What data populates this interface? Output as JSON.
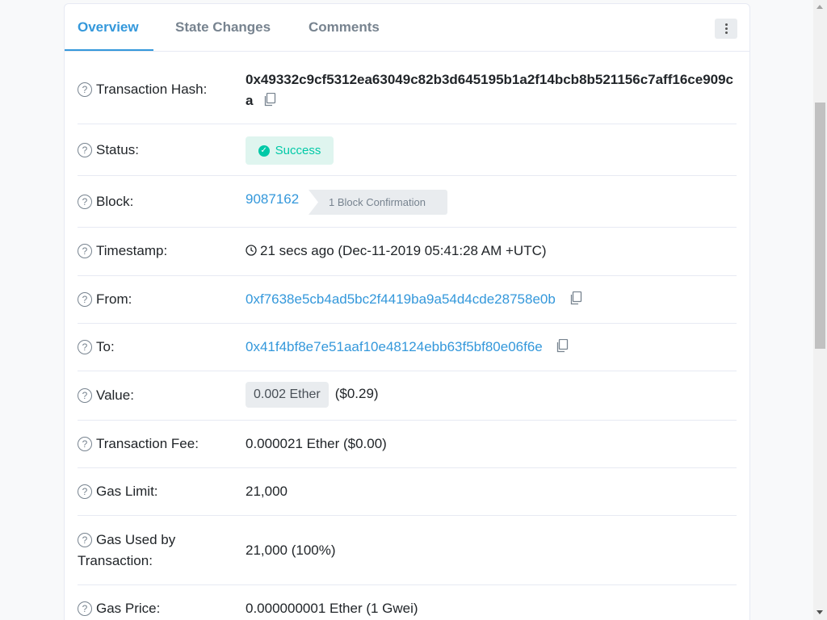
{
  "tabs": [
    {
      "label": "Overview",
      "active": true
    },
    {
      "label": "State Changes",
      "active": false
    },
    {
      "label": "Comments",
      "active": false
    }
  ],
  "rows": {
    "tx_hash": {
      "label": "Transaction Hash:",
      "value": "0x49332c9cf5312ea63049c82b3d645195b1a2f14bcb8b521156c7aff16ce909ca"
    },
    "status": {
      "label": "Status:",
      "value": "Success"
    },
    "block": {
      "label": "Block:",
      "value": "9087162",
      "confirmations": "1 Block Confirmation"
    },
    "timestamp": {
      "label": "Timestamp:",
      "value": "21 secs ago (Dec-11-2019 05:41:28 AM +UTC)"
    },
    "from": {
      "label": "From:",
      "value": "0xf7638e5cb4ad5bc2f4419ba9a54d4cde28758e0b"
    },
    "to": {
      "label": "To:",
      "value": "0x41f4bf8e7e51aaf10e48124ebb63f5bf80e06f6e"
    },
    "value": {
      "label": "Value:",
      "amount": "0.002 Ether",
      "usd": "($0.29)"
    },
    "fee": {
      "label": "Transaction Fee:",
      "value": "0.000021 Ether ($0.00)"
    },
    "gas_limit": {
      "label": "Gas Limit:",
      "value": "21,000"
    },
    "gas_used": {
      "label_line1": "Gas Used by",
      "label_line2": "Transaction:",
      "value": "21,000 (100%)"
    },
    "gas_price": {
      "label": "Gas Price:",
      "value": "0.000000001 Ether (1 Gwei)"
    }
  },
  "icons": {
    "help": "question-circle-icon",
    "copy": "copy-icon",
    "success": "check-circle-icon",
    "clock": "clock-icon",
    "more": "vertical-dots-icon"
  },
  "colors": {
    "accent": "#3498db",
    "success": "#00c9a7",
    "success_bg": "#dff5ef",
    "muted": "#77838f"
  }
}
